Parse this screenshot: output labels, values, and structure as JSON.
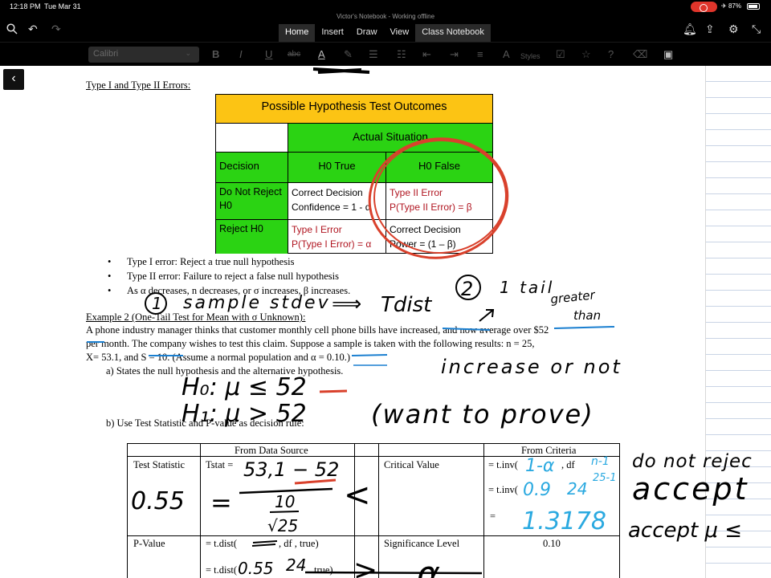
{
  "status": {
    "time": "12:18 PM",
    "date": "Tue Mar 31",
    "battery": "87%",
    "window_title": "Victor's Notebook - Working offline"
  },
  "tabs": [
    "Home",
    "Insert",
    "Draw",
    "View",
    "Class Notebook"
  ],
  "ribbon": {
    "font_name": "Calibri",
    "styles_label": "Styles"
  },
  "doc": {
    "heading": "Type I and Type II Errors:",
    "table": {
      "title": "Possible Hypothesis Test Outcomes",
      "actual": "Actual Situation",
      "decision": "Decision",
      "h0_true": "H0 True",
      "h0_false": "H0 False",
      "row1_label": "Do Not Reject H0",
      "row1_c1a": "Correct Decision",
      "row1_c1b": "Confidence = 1 - α",
      "row1_c2a": "Type II Error",
      "row1_c2b": "P(Type II Error) = β",
      "row2_label": "Reject H0",
      "row2_c1a": "Type I Error",
      "row2_c1b": "P(Type I Error) = α",
      "row2_c2a": "Correct Decision",
      "row2_c2b": "Power =  (1 – β)"
    },
    "bullets": [
      "Type I error: Reject a true null hypothesis",
      "Type II error: Failure to reject a false null hypothesis",
      "As α decreases, n decreases, or σ increases, β increases."
    ],
    "example_title": "Example 2 (One-Tail Test for Mean with σ Unknown):",
    "para1": "A phone industry manager thinks that customer monthly cell phone bills have increased, and now average over $52",
    "para2": "per month.  The company wishes to test this claim.  Suppose a sample is taken with the following results:   n = 25,",
    "para3": "X= 53.1, and S = 10. (Assume a normal population and α = 0.10.)",
    "qa": "a)    States the null hypothesis and the alternative hypothesis.",
    "qb": "b)    Use Test Statistic and P-value as decision rule:",
    "t_from_data": "From Data Source",
    "t_from_criteria": "From Criteria",
    "t_test_stat": "Test Statistic",
    "t_tstat": "Tstat =",
    "t_critical": "Critical Value",
    "t_tinv1": "= t.inv(",
    "t_df": ", df",
    "t_tinv2": "= t.inv(",
    "t_eq": "=",
    "t_pvalue": "P-Value",
    "t_tdist1": "= t.dist(",
    "t_tdist1b": ", df    , true)",
    "t_tdist2": "= t.dist(",
    "t_tdist2b": "true)",
    "t_sig": "Significance Level",
    "t_sig_val": "0.10"
  },
  "ink": {
    "one": "1",
    "sample_stdev": "sample stdev",
    "arrow": "⟹",
    "tdist": "Tdist",
    "two": "2",
    "one_tail": "1 tail",
    "greater_than": "greater than",
    "increase_or_not": "increase or not",
    "h0": "H₀:  μ ≤ 52",
    "h1": "H₁:  μ > 52",
    "want_to_prove": "(want to prove)",
    "num": "53,1 − 52",
    "den_top": "10",
    "den_bot": "√25",
    "eq": "=",
    "stat_val": "0.55",
    "lt": "<",
    "one_minus_alpha": "1-α",
    "n_minus_1": "n-1",
    "c09": "0.9",
    "c24": "24",
    "c25_1": "25-1",
    "crit": "1.3178",
    "do_not_reject": "do not rejec",
    "accept": "accept",
    "accept_mu": "accept μ ≤",
    "pv_055": "0.55",
    "pv_24": "24",
    "gt": ">",
    "alpha": "α"
  }
}
